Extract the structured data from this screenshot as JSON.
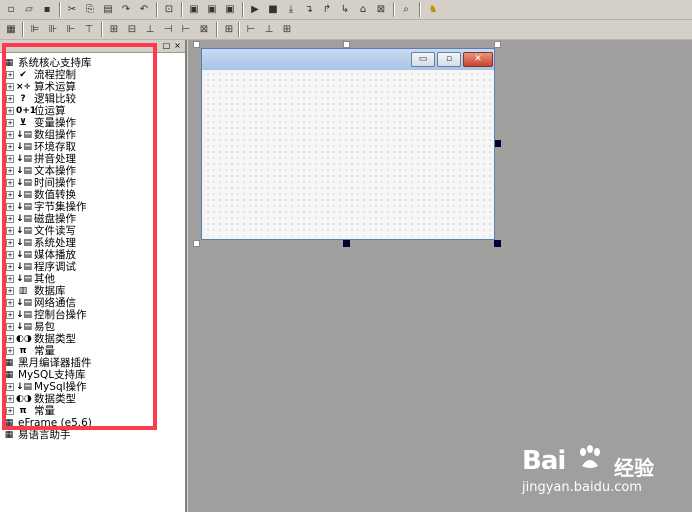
{
  "toolbar1": {
    "icons": [
      "new-icon",
      "open-icon",
      "save-icon",
      "cut-icon",
      "copy-icon",
      "paste-icon",
      "redo-icon",
      "undo-icon",
      "preview-icon",
      "layout-icon",
      "layout2-icon",
      "layout3-icon",
      "run-icon",
      "stop-icon",
      "step-icon",
      "step-into-icon",
      "step-out-icon",
      "step-over-icon",
      "breakpoint-icon",
      "clear-icon",
      "find-icon"
    ]
  },
  "toolbar2": {
    "icons": [
      "align-left-icon",
      "align-center-icon",
      "align-right-icon",
      "align-top-icon",
      "same-size-icon",
      "space-h-icon",
      "space-v-icon",
      "center-h-icon",
      "center-v-icon",
      "grid-icon"
    ]
  },
  "left_panel": {
    "header_controls": [
      "□",
      "×"
    ],
    "tree": [
      {
        "label": "系统核心支持库",
        "icon": "library-icon",
        "glyph": "▦",
        "top": true
      },
      {
        "label": "流程控制",
        "icon": "flow-control-icon",
        "glyph": "✔"
      },
      {
        "label": "算术运算",
        "icon": "arithmetic-icon",
        "glyph": "×÷"
      },
      {
        "label": "逻辑比较",
        "icon": "logic-icon",
        "glyph": "?"
      },
      {
        "label": "位运算",
        "icon": "bitwise-icon",
        "glyph": "0+1"
      },
      {
        "label": "变量操作",
        "icon": "variable-icon",
        "glyph": "⊻"
      },
      {
        "label": "数组操作",
        "icon": "category-icon",
        "glyph": "↓▤"
      },
      {
        "label": "环境存取",
        "icon": "category-icon",
        "glyph": "↓▤"
      },
      {
        "label": "拼音处理",
        "icon": "category-icon",
        "glyph": "↓▤"
      },
      {
        "label": "文本操作",
        "icon": "category-icon",
        "glyph": "↓▤"
      },
      {
        "label": "时间操作",
        "icon": "category-icon",
        "glyph": "↓▤"
      },
      {
        "label": "数值转换",
        "icon": "category-icon",
        "glyph": "↓▤"
      },
      {
        "label": "字节集操作",
        "icon": "category-icon",
        "glyph": "↓▤"
      },
      {
        "label": "磁盘操作",
        "icon": "category-icon",
        "glyph": "↓▤"
      },
      {
        "label": "文件读写",
        "icon": "category-icon",
        "glyph": "↓▤"
      },
      {
        "label": "系统处理",
        "icon": "category-icon",
        "glyph": "↓▤"
      },
      {
        "label": "媒体播放",
        "icon": "category-icon",
        "glyph": "↓▤"
      },
      {
        "label": "程序调试",
        "icon": "category-icon",
        "glyph": "↓▤"
      },
      {
        "label": "其他",
        "icon": "category-icon",
        "glyph": "↓▤"
      },
      {
        "label": "数据库",
        "icon": "database-icon",
        "glyph": "▥"
      },
      {
        "label": "网络通信",
        "icon": "category-icon",
        "glyph": "↓▤"
      },
      {
        "label": "控制台操作",
        "icon": "category-icon",
        "glyph": "↓▤"
      },
      {
        "label": "易包",
        "icon": "category-icon",
        "glyph": "↓▤"
      },
      {
        "label": "数据类型",
        "icon": "datatype-icon",
        "glyph": "◐◑"
      },
      {
        "label": "常量",
        "icon": "constant-icon",
        "glyph": "π"
      },
      {
        "label": "黑月编译器插件",
        "icon": "library-icon",
        "glyph": "▦",
        "top": true
      },
      {
        "label": "MySQL支持库",
        "icon": "library-icon",
        "glyph": "▦",
        "top": true
      },
      {
        "label": "MySql操作",
        "icon": "category-icon",
        "glyph": "↓▤"
      },
      {
        "label": "数据类型",
        "icon": "datatype-icon",
        "glyph": "◐◑"
      },
      {
        "label": "常量",
        "icon": "constant-icon",
        "glyph": "π"
      },
      {
        "label": "eFrame (e5.6)",
        "icon": "library-icon",
        "glyph": "▦",
        "top": true
      },
      {
        "label": "易语言助手",
        "icon": "library-icon",
        "glyph": "▦",
        "top": true
      }
    ]
  },
  "form_window": {
    "buttons": {
      "minimize": "▭",
      "maximize": "▫",
      "close": "✕"
    }
  },
  "watermark": {
    "brand_left": "Bai",
    "brand_right_cn": "经验",
    "url": "jingyan.baidu.com"
  },
  "colors": {
    "highlight_box": "#ff3a4d",
    "canvas": "#a09f9e",
    "form_title": "#b7cfee"
  }
}
